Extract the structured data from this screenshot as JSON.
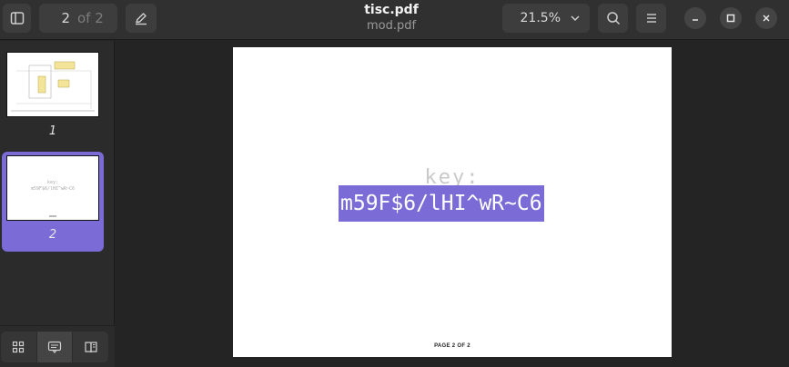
{
  "header": {
    "title": "tisc.pdf",
    "subtitle": "mod.pdf",
    "page_current": "2",
    "page_of": "of 2",
    "zoom": "21.5%"
  },
  "icons": {
    "sidebar_toggle": "sidebar-icon",
    "annotate": "pen-icon",
    "zoom_dropdown": "chevron-down-icon",
    "search": "search-icon",
    "menu": "hamburger-icon",
    "minimize": "minimize-icon",
    "maximize": "maximize-icon",
    "close": "close-icon",
    "thumbnails_view": "grid-icon",
    "annotations_view": "comments-icon",
    "bookmarks_view": "bookmarks-icon"
  },
  "sidebar": {
    "thumbnails": [
      {
        "label": "1",
        "selected": false
      },
      {
        "label": "2",
        "selected": true
      }
    ]
  },
  "document": {
    "key_label": "key:",
    "key_value": "m59F$6/lHI^wR~C6",
    "footer": "PAGE 2 OF 2"
  },
  "colors": {
    "accent": "#7a6bd6",
    "header_bg": "#303030",
    "sidebar_bg": "#2b2b2b",
    "canvas_bg": "#242424"
  }
}
